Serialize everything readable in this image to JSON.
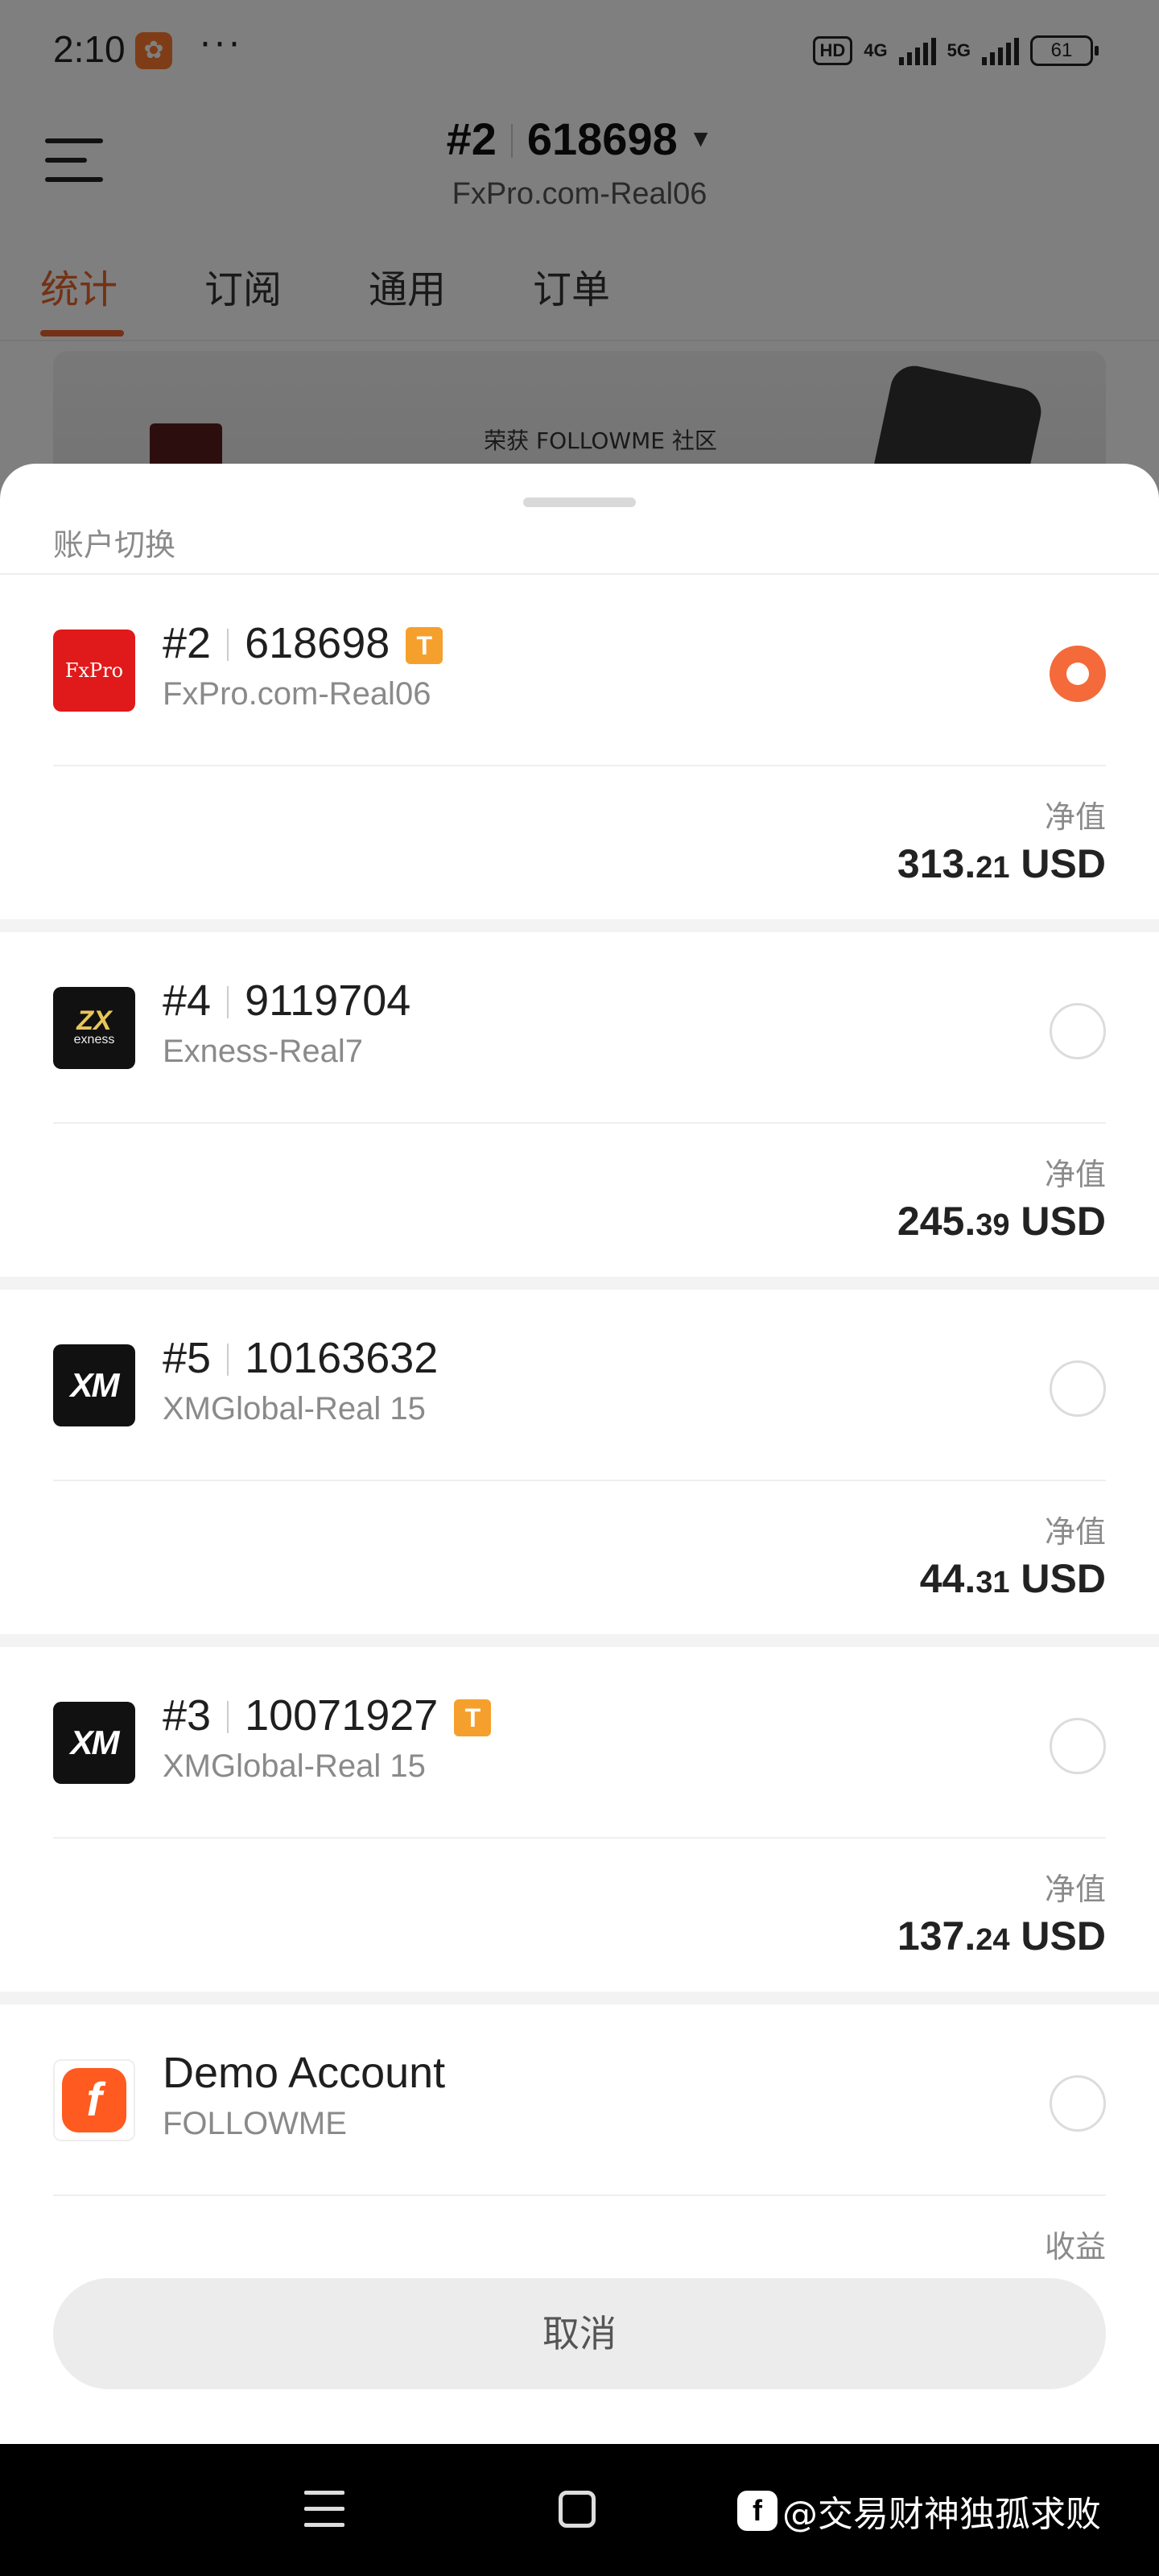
{
  "status_bar": {
    "time": "2:10",
    "dots": "···",
    "hd": "HD",
    "net1": "4G",
    "net2": "5G",
    "battery": "61"
  },
  "header": {
    "account_no": "#2",
    "account_id": "618698",
    "server": "FxPro.com-Real06"
  },
  "tabs": [
    "统计",
    "订阅",
    "通用",
    "订单"
  ],
  "banner": {
    "text": "荣获 FOLLOWME 社区"
  },
  "sheet": {
    "title": "账户切换",
    "equity_label": "净值",
    "accounts": [
      {
        "no": "#2",
        "id": "618698",
        "badge": "T",
        "server": "FxPro.com-Real06",
        "logo": "fxpro-logo",
        "logo_text": "FxPro",
        "selected": true,
        "label": "净值",
        "value_int": "313.",
        "value_dec": "21",
        "currency": "USD"
      },
      {
        "no": "#4",
        "id": "9119704",
        "badge": "",
        "server": "Exness-Real7",
        "logo": "exness-logo",
        "logo_text": "exness",
        "selected": false,
        "label": "净值",
        "value_int": "245.",
        "value_dec": "39",
        "currency": "USD"
      },
      {
        "no": "#5",
        "id": "10163632",
        "badge": "",
        "server": "XMGlobal-Real 15",
        "logo": "xm-logo",
        "logo_text": "XM",
        "selected": false,
        "label": "净值",
        "value_int": "44.",
        "value_dec": "31",
        "currency": "USD"
      },
      {
        "no": "#3",
        "id": "10071927",
        "badge": "T",
        "server": "XMGlobal-Real 15",
        "logo": "xm-logo",
        "logo_text": "XM",
        "selected": false,
        "label": "净值",
        "value_int": "137.",
        "value_dec": "24",
        "currency": "USD"
      },
      {
        "name": "Demo Account",
        "server": "FOLLOWME",
        "logo": "followme-logo",
        "logo_text": "f",
        "selected": false,
        "label": "收益"
      }
    ],
    "cancel_label": "取消"
  },
  "watermark": {
    "logo": "f",
    "text": "@交易财神独孤求败"
  },
  "colors": {
    "accent": "#f46a3a",
    "badge": "#f5a02c",
    "tab_active": "#e8632a"
  }
}
